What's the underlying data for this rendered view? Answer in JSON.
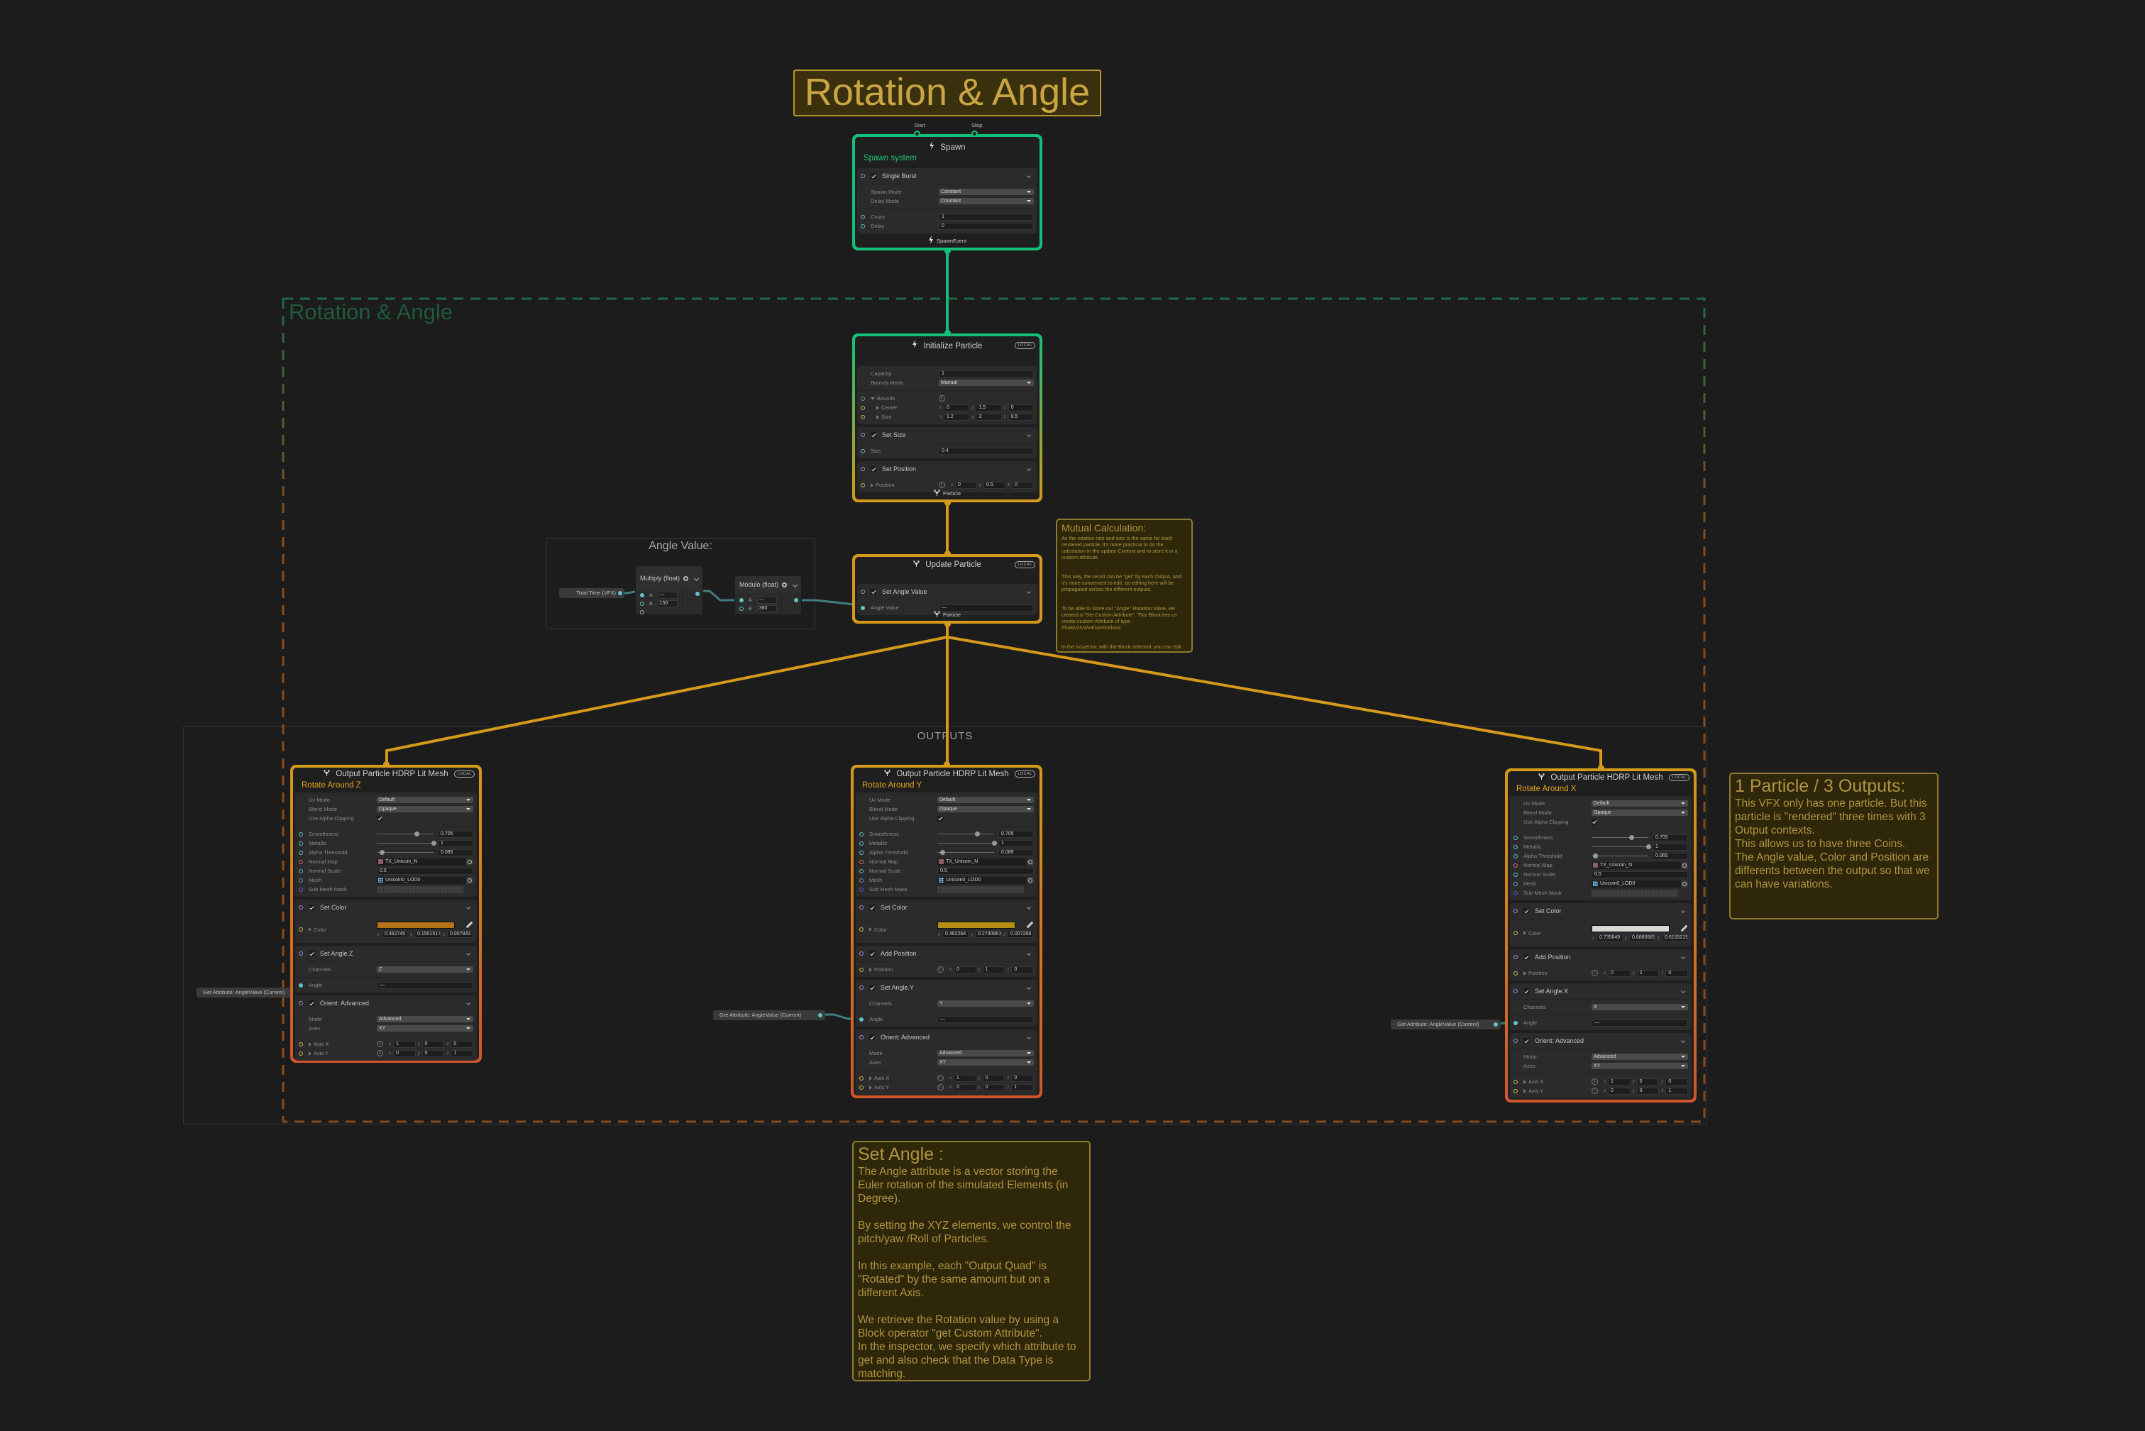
{
  "title_box": "Rotation & Angle",
  "group": {
    "label": "Rotation & Angle",
    "color_top": "#1d6b45",
    "color_bottom": "#8a4a1a"
  },
  "outputs_group": {
    "label": "OUTPUTS"
  },
  "port_colors": {
    "flow": "#a88bd6",
    "float": "#63c2c8",
    "vector": "#cdb84a",
    "texture": "#c56b6b",
    "mesh": "#6a8fd8",
    "uint": "#6657c9",
    "bounds": "#8a8a8a"
  },
  "axes": [
    "x",
    "y",
    "z"
  ],
  "angle_group": {
    "label": "Angle Value:",
    "total_time": "Total Time (VFX)",
    "multiply": {
      "title": "Multiply (float)",
      "a": "A",
      "b": "B",
      "a_value": "—",
      "b_value": "150"
    },
    "modulo": {
      "title": "Modulo (float)",
      "a": "A",
      "b": "B",
      "a_value": "—",
      "b_value": "360"
    }
  },
  "get_attribute": [
    "Get Attribute: AngleValue (Current)",
    "Get Attribute: AngleValue (Current)",
    "Get Attribute: AngleValue (Current)"
  ],
  "nodes": {
    "spawn": {
      "title": "Spawn",
      "icon": "lightning-icon",
      "subtitle": "Spawn system",
      "subtitle_color": "#22c47a",
      "border": [
        "#13c07a",
        "#13c07a"
      ],
      "top_ports": [
        "Start",
        "Stop"
      ],
      "footer": "SpawnEvent",
      "blocks": [
        {
          "title": "Single Burst",
          "checked": true,
          "sections": [
            [
              {
                "label": "Spawn Mode",
                "dropdown": "Constant"
              },
              {
                "label": "Delay Mode",
                "dropdown": "Constant"
              }
            ],
            [
              {
                "label": "Count",
                "port": "float",
                "field": "1"
              },
              {
                "label": "Delay",
                "port": "float",
                "field": "0"
              }
            ]
          ]
        }
      ]
    },
    "init": {
      "title": "Initialize Particle",
      "icon": "lightning-icon",
      "badge": "LOCAL",
      "border": [
        "#13c07a",
        "#d69a1a"
      ],
      "footer": "Particle",
      "blocks": [
        {
          "sections": [
            [
              {
                "label": "Capacity",
                "field": "1"
              },
              {
                "label": "Bounds Mode",
                "dropdown": "Manual"
              }
            ],
            [
              {
                "label": "Bounds",
                "port": "bounds",
                "expand": "open",
                "local": true
              },
              {
                "label": "Center",
                "port": "vector",
                "expand": "closed",
                "indent": true,
                "vec": [
                  "0",
                  "1.5",
                  "0"
                ]
              },
              {
                "label": "Size",
                "port": "vector",
                "expand": "closed",
                "indent": true,
                "vec": [
                  "1.2",
                  "3",
                  "0.5"
                ]
              }
            ]
          ]
        },
        {
          "title": "Set Size",
          "checked": true,
          "sections": [
            [
              {
                "label": "Size",
                "port": "float",
                "field": "0.4"
              }
            ]
          ]
        },
        {
          "title": "Set Position",
          "checked": true,
          "sections": [
            [
              {
                "label": "Position",
                "port": "vector",
                "expand": "closed",
                "local": true,
                "vec": [
                  "0",
                  "0.5",
                  "0"
                ]
              }
            ]
          ]
        }
      ]
    },
    "update": {
      "title": "Update Particle",
      "icon": "particle-icon",
      "badge": "LOCAL",
      "border": [
        "#d69a1a",
        "#d69a1a"
      ],
      "footer": "Particle",
      "blocks": [
        {
          "title": "Set Angle Value",
          "checked": true,
          "sections": [
            [
              {
                "label": "Angle Value",
                "port": "float",
                "connected": true,
                "field": "—"
              }
            ]
          ]
        }
      ]
    },
    "outZ": {
      "title": "Output Particle HDRP Lit Mesh",
      "icon": "particle-icon",
      "badge": "LOCAL",
      "subtitle": "Rotate Around Z",
      "subtitle_color": "#e0a31b",
      "border": [
        "#d69a1a",
        "#d0552a"
      ],
      "blocks": [
        {
          "sections": [
            [
              {
                "label": "Uv Mode",
                "dropdown": "Default"
              },
              {
                "label": "Blend Mode",
                "dropdown": "Opaque"
              },
              {
                "label": "Use Alpha Clipping",
                "check": true
              }
            ],
            [
              {
                "label": "Smoothness",
                "port": "float",
                "slider": true,
                "field": "0.705"
              },
              {
                "label": "Metallic",
                "port": "float",
                "slider": true,
                "field": "1"
              },
              {
                "label": "Alpha Threshold",
                "port": "float",
                "slider": true,
                "field": "0.085"
              },
              {
                "label": "Normal Map",
                "port": "texture",
                "asset": "TX_Unicoin_N",
                "asset_icon": "texture"
              },
              {
                "label": "Normal Scale",
                "port": "float",
                "field": "0.5"
              },
              {
                "label": "Mesh",
                "port": "mesh",
                "asset": "Unicoin0_LOD0",
                "asset_icon": "mesh"
              },
              {
                "label": "Sub Mesh Mask",
                "port": "uint",
                "mask": true
              }
            ]
          ]
        },
        {
          "title": "Set Color",
          "checked": true,
          "sections": [
            [
              {
                "label": "Color",
                "port": "vector",
                "expand": "closed",
                "swatch": "#b87318",
                "vec": [
                  "0.462745",
                  "0.1501517",
                  "0.007843"
                ]
              }
            ]
          ]
        },
        {
          "title": "Set Angle.Z",
          "checked": true,
          "sections": [
            [
              {
                "label": "Channels",
                "dropdown": "Z"
              }
            ],
            [
              {
                "label": "Angle",
                "port": "float",
                "connected": true,
                "field": "—"
              }
            ]
          ]
        },
        {
          "title": "Orient: Advanced",
          "checked": true,
          "sections": [
            [
              {
                "label": "Mode",
                "dropdown": "Advanced"
              },
              {
                "label": "Axes",
                "dropdown": "XY"
              }
            ],
            [
              {
                "label": "Axis X",
                "port": "vector",
                "expand": "closed",
                "local": true,
                "vec": [
                  "1",
                  "0",
                  "0"
                ]
              },
              {
                "label": "Axis Y",
                "port": "vector",
                "expand": "closed",
                "local": true,
                "vec": [
                  "0",
                  "0",
                  "1"
                ]
              }
            ]
          ]
        }
      ]
    },
    "outY": {
      "title": "Output Particle HDRP Lit Mesh",
      "icon": "particle-icon",
      "badge": "LOCAL",
      "subtitle": "Rotate Around Y",
      "subtitle_color": "#e0a31b",
      "border": [
        "#d69a1a",
        "#d0552a"
      ],
      "blocks": [
        {
          "sections": [
            [
              {
                "label": "Uv Mode",
                "dropdown": "Default"
              },
              {
                "label": "Blend Mode",
                "dropdown": "Opaque"
              },
              {
                "label": "Use Alpha Clipping",
                "check": true
              }
            ],
            [
              {
                "label": "Smoothness",
                "port": "float",
                "slider": true,
                "field": "0.705"
              },
              {
                "label": "Metallic",
                "port": "float",
                "slider": true,
                "field": "1"
              },
              {
                "label": "Alpha Threshold",
                "port": "float",
                "slider": true,
                "field": "0.085"
              },
              {
                "label": "Normal Map",
                "port": "texture",
                "asset": "TX_Unicoin_N",
                "asset_icon": "texture"
              },
              {
                "label": "Normal Scale",
                "port": "float",
                "field": "0.5"
              },
              {
                "label": "Mesh",
                "port": "mesh",
                "asset": "Unicoin0_LOD0",
                "asset_icon": "mesh"
              },
              {
                "label": "Sub Mesh Mask",
                "port": "uint",
                "mask": true
              }
            ]
          ]
        },
        {
          "title": "Set Color",
          "checked": true,
          "sections": [
            [
              {
                "label": "Color",
                "port": "vector",
                "expand": "closed",
                "swatch": "#b58f14",
                "vec": [
                  "0.462264",
                  "0.2740961",
                  "0.007268"
                ]
              }
            ]
          ]
        },
        {
          "title": "Add Position",
          "checked": true,
          "sections": [
            [
              {
                "label": "Position",
                "port": "vector",
                "expand": "closed",
                "local": true,
                "vec": [
                  "0",
                  "1",
                  "0"
                ]
              }
            ]
          ]
        },
        {
          "title": "Set Angle.Y",
          "checked": true,
          "sections": [
            [
              {
                "label": "Channels",
                "dropdown": "Y"
              }
            ],
            [
              {
                "label": "Angle",
                "port": "float",
                "connected": true,
                "field": "—"
              }
            ]
          ]
        },
        {
          "title": "Orient: Advanced",
          "checked": true,
          "sections": [
            [
              {
                "label": "Mode",
                "dropdown": "Advanced"
              },
              {
                "label": "Axes",
                "dropdown": "XY"
              }
            ],
            [
              {
                "label": "Axis X",
                "port": "vector",
                "expand": "closed",
                "local": true,
                "vec": [
                  "1",
                  "0",
                  "0"
                ]
              },
              {
                "label": "Axis Y",
                "port": "vector",
                "expand": "closed",
                "local": true,
                "vec": [
                  "0",
                  "0",
                  "1"
                ]
              }
            ]
          ]
        }
      ]
    },
    "outX": {
      "title": "Output Particle HDRP Lit Mesh",
      "icon": "particle-icon",
      "badge": "LOCAL",
      "subtitle": "Rotate Around X",
      "subtitle_color": "#e0a31b",
      "border": [
        "#d69a1a",
        "#d0552a"
      ],
      "blocks": [
        {
          "sections": [
            [
              {
                "label": "Uv Mode",
                "dropdown": "Default"
              },
              {
                "label": "Blend Mode",
                "dropdown": "Opaque"
              },
              {
                "label": "Use Alpha Clipping",
                "check": true
              }
            ],
            [
              {
                "label": "Smoothness",
                "port": "float",
                "slider": true,
                "field": "0.705"
              },
              {
                "label": "Metallic",
                "port": "float",
                "slider": true,
                "field": "1"
              },
              {
                "label": "Alpha Threshold",
                "port": "float",
                "slider": true,
                "field": "0.065"
              },
              {
                "label": "Normal Map",
                "port": "texture",
                "asset": "TX_Unicoin_N",
                "asset_icon": "texture"
              },
              {
                "label": "Normal Scale",
                "port": "float",
                "field": "0.5"
              },
              {
                "label": "Mesh",
                "port": "mesh",
                "asset": "Unicoin0_LOD0",
                "asset_icon": "mesh"
              },
              {
                "label": "Sub Mesh Mask",
                "port": "uint",
                "mask": true
              }
            ]
          ]
        },
        {
          "title": "Set Color",
          "checked": true,
          "sections": [
            [
              {
                "label": "Color",
                "port": "vector",
                "expand": "closed",
                "swatch": "#dcd7d2",
                "vec": [
                  "0.735849",
                  "0.6860583",
                  "0.6155215"
                ]
              }
            ]
          ]
        },
        {
          "title": "Add Position",
          "checked": true,
          "sections": [
            [
              {
                "label": "Position",
                "port": "vector",
                "expand": "closed",
                "local": true,
                "vec": [
                  "0",
                  "2",
                  "0"
                ]
              }
            ]
          ]
        },
        {
          "title": "Set Angle.X",
          "checked": true,
          "sections": [
            [
              {
                "label": "Channels",
                "dropdown": "X"
              }
            ],
            [
              {
                "label": "Angle",
                "port": "float",
                "connected": true,
                "field": "—"
              }
            ]
          ]
        },
        {
          "title": "Orient: Advanced",
          "checked": true,
          "sections": [
            [
              {
                "label": "Mode",
                "dropdown": "Advanced"
              },
              {
                "label": "Axes",
                "dropdown": "XY"
              }
            ],
            [
              {
                "label": "Axis X",
                "port": "vector",
                "expand": "closed",
                "local": true,
                "vec": [
                  "1",
                  "0",
                  "0"
                ]
              },
              {
                "label": "Axis Y",
                "port": "vector",
                "expand": "closed",
                "local": true,
                "vec": [
                  "0",
                  "0",
                  "1"
                ]
              }
            ]
          ]
        }
      ]
    }
  },
  "notes": {
    "mutual": {
      "title": "Mutual Calculation:",
      "body": "As the rotation rate and size is the same for each rendered particle, it's more practical to do the calculation in the update Context and to store it in a custom attribute.\n\n\nThis way, the result can be \"get\" by each Output, and it's more convenient to edit, as editing here will be propagated across the different outputs.\n\n\nTo be able to Store our \"Angle\" Rotation Value, we created a \"Set Custom Attribute\". This Block lets us create custom Attribute of type :\nFloat/v2/v3/v4/uint/int/bool\n\n\nIn the Inspector, with the Block selected, you can edit the Attribute Name and the data Type."
    },
    "particle": {
      "title": "1 Particle / 3 Outputs:",
      "body": "This VFX only has one particle. But this particle is \"rendered\" three times with 3 Output contexts.\nThis allows us to have three Coins.\nThe Angle value, Color and Position are differents between the output so that we can have variations."
    },
    "set_angle": {
      "title": "Set Angle :",
      "body": "The Angle attribute is a vector storing the Euler rotation of the simulated Elements (in Degree).\n\nBy setting the XYZ elements, we control the pitch/yaw /Roll of Particles.\n\nIn this example, each \"Output Quad\" is \"Rotated\" by the same amount but on a different Axis.\n\nWe retrieve the Rotation value by using a Block operator \"get Custom Attribute\".\nIn the inspector, we specify which attribute to get and also check that the Data Type is matching."
    }
  }
}
